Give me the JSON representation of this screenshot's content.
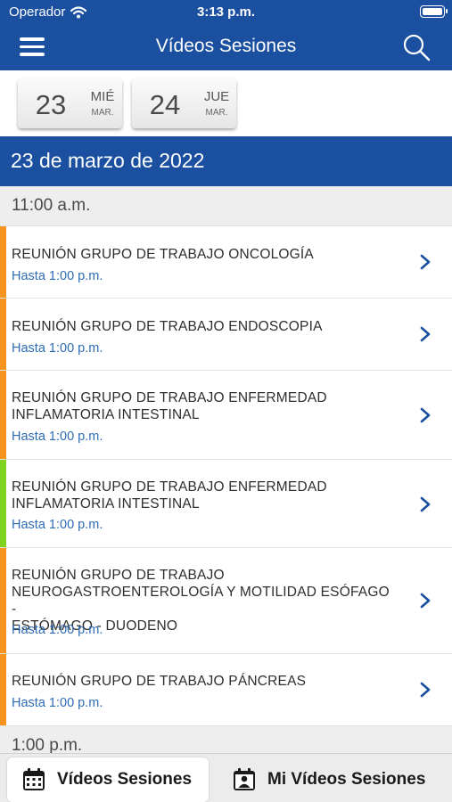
{
  "status_bar": {
    "carrier": "Operador",
    "time": "3:13 p.m."
  },
  "nav": {
    "title": "Vídeos Sesiones"
  },
  "date_selector": [
    {
      "day": "23",
      "weekday": "MIÉ",
      "month": "MAR."
    },
    {
      "day": "24",
      "weekday": "JUE",
      "month": "MAR."
    }
  ],
  "selected_date": "23 de marzo de 2022",
  "time_groups": [
    {
      "time": "11:00 a.m."
    },
    {
      "time": "1:00 p.m."
    }
  ],
  "sessions": [
    {
      "lines": [
        "REUNIÓN GRUPO DE TRABAJO  ONCOLOGÍA"
      ],
      "until": "Hasta 1:00 p.m.",
      "color": "#f7941d"
    },
    {
      "lines": [
        "REUNIÓN GRUPO DE TRABAJO ENDOSCOPIA"
      ],
      "until": "Hasta 1:00 p.m.",
      "color": "#f7941d"
    },
    {
      "lines": [
        "REUNIÓN GRUPO DE TRABAJO ENFERMEDAD",
        "INFLAMATORIA INTESTINAL"
      ],
      "until": "Hasta 1:00 p.m.",
      "color": "#f7941d"
    },
    {
      "lines": [
        "REUNIÓN GRUPO DE TRABAJO ENFERMEDAD",
        "INFLAMATORIA INTESTINAL"
      ],
      "until": "Hasta 1:00 p.m.",
      "color": "#7ed321"
    },
    {
      "lines": [
        "REUNIÓN GRUPO DE TRABAJO",
        "NEUROGASTROENTEROLOGÍA Y MOTILIDAD  ESÓFAGO -",
        "ESTÓMAGO - DUODENO"
      ],
      "until": "Hasta 1:00 p.m.",
      "color": "#f7941d"
    },
    {
      "lines": [
        "REUNIÓN GRUPO DE TRABAJO PÁNCREAS"
      ],
      "until": "Hasta 1:00 p.m.",
      "color": "#f7941d"
    }
  ],
  "tabs": [
    {
      "label": "Vídeos Sesiones",
      "icon": "calendar-icon",
      "active": true
    },
    {
      "label": "Mi Vídeos Sesiones",
      "icon": "calendar-person-icon",
      "active": false
    }
  ],
  "colors": {
    "brand": "#1b4fa0",
    "link": "#2e6cb5",
    "accent_orange": "#f7941d",
    "accent_green": "#7ed321"
  }
}
